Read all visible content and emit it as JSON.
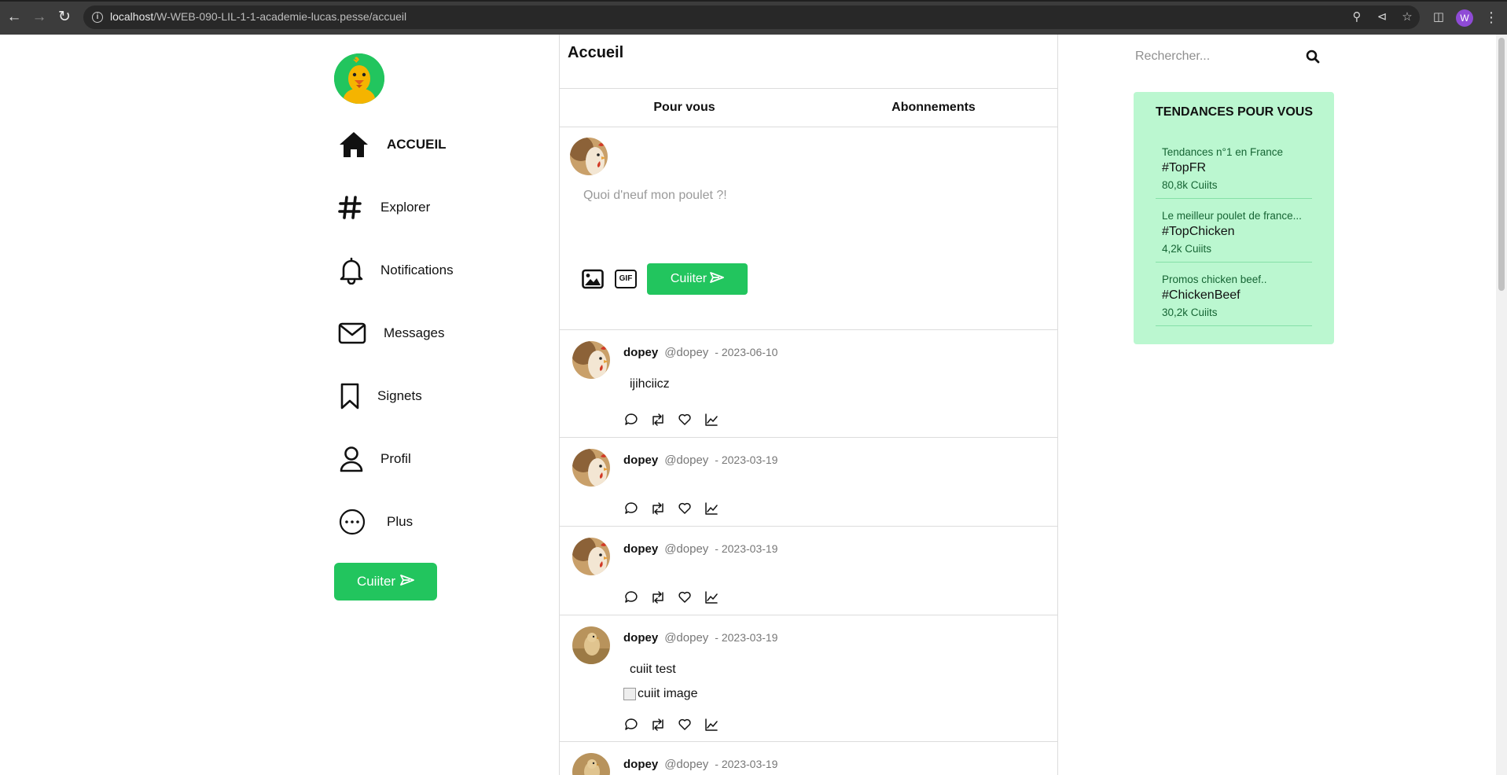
{
  "browser": {
    "url_host": "localhost",
    "url_path": "/W-WEB-090-LIL-1-1-academie-lucas.pesse/accueil",
    "profile_initial": "W"
  },
  "sidebar": {
    "items": [
      {
        "label": "ACCUEIL",
        "icon": "home-icon"
      },
      {
        "label": "Explorer",
        "icon": "hashtag-icon"
      },
      {
        "label": "Notifications",
        "icon": "bell-icon"
      },
      {
        "label": "Messages",
        "icon": "envelope-icon"
      },
      {
        "label": "Signets",
        "icon": "bookmark-icon"
      },
      {
        "label": "Profil",
        "icon": "user-icon"
      },
      {
        "label": "Plus",
        "icon": "more-icon"
      }
    ],
    "post_button": "Cuiiter"
  },
  "main": {
    "title": "Accueil",
    "tabs": [
      {
        "label": "Pour vous"
      },
      {
        "label": "Abonnements"
      }
    ],
    "composer": {
      "placeholder": "Quoi d'neuf mon poulet ?!",
      "gif_label": "GIF",
      "submit": "Cuiiter"
    },
    "posts": [
      {
        "name": "dopey",
        "handle": "@dopey",
        "date": "- 2023-06-10",
        "text": "ijihciicz",
        "image_alt": ""
      },
      {
        "name": "dopey",
        "handle": "@dopey",
        "date": "- 2023-03-19",
        "text": "",
        "image_alt": ""
      },
      {
        "name": "dopey",
        "handle": "@dopey",
        "date": "- 2023-03-19",
        "text": "",
        "image_alt": ""
      },
      {
        "name": "dopey",
        "handle": "@dopey",
        "date": "- 2023-03-19",
        "text": "cuiit test",
        "image_alt": "cuiit image"
      },
      {
        "name": "dopey",
        "handle": "@dopey",
        "date": "- 2023-03-19",
        "text": "",
        "image_alt": ""
      }
    ]
  },
  "right": {
    "search_placeholder": "Rechercher...",
    "trends_title": "TENDANCES POUR VOUS",
    "trends": [
      {
        "context": "Tendances n°1 en France",
        "tag": "#TopFR",
        "count": "80,8k Cuiits"
      },
      {
        "context": "Le meilleur poulet de france...",
        "tag": "#TopChicken",
        "count": "4,2k Cuiits"
      },
      {
        "context": "Promos chicken beef..",
        "tag": "#ChickenBeef",
        "count": "30,2k Cuiits"
      }
    ]
  },
  "colors": {
    "accent": "#22c55e",
    "trends_bg": "#bbf7d0",
    "chrome": "#3c3c3c"
  }
}
